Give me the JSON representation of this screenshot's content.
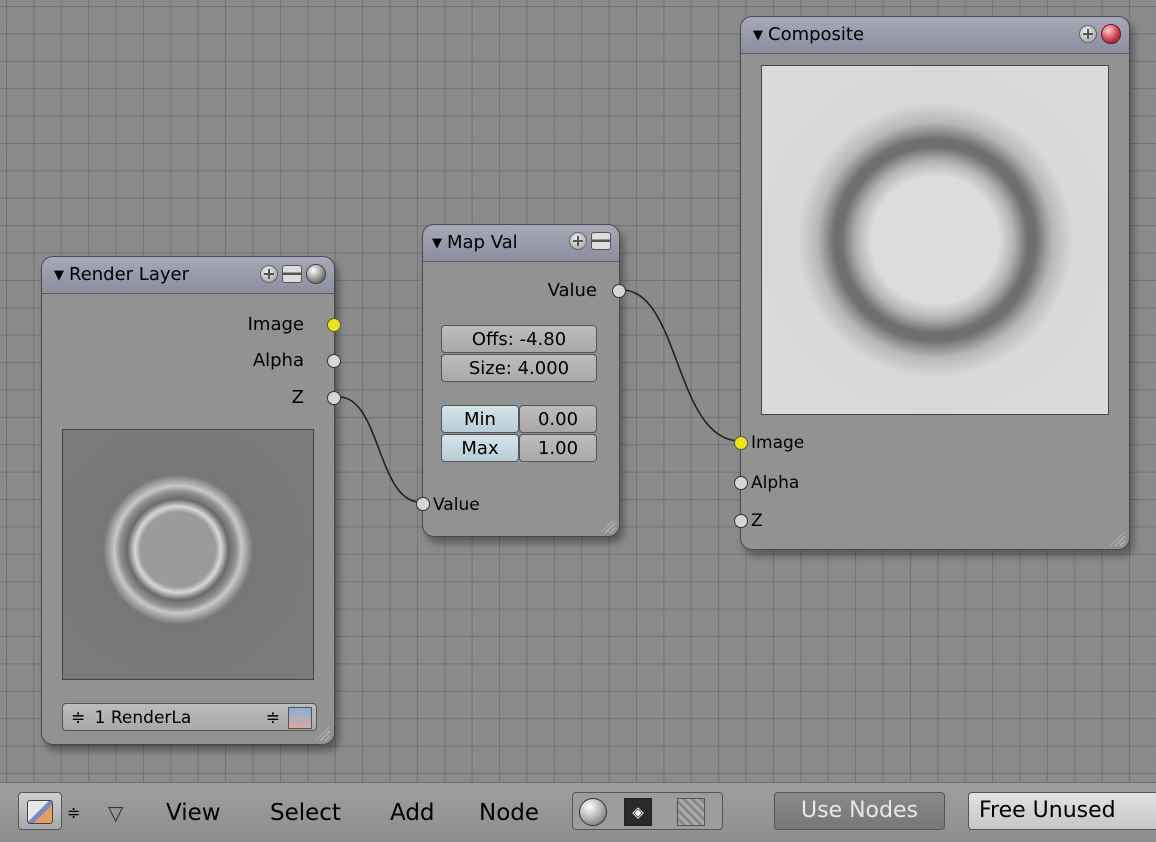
{
  "nodes": {
    "render_layer": {
      "title": "Render Layer",
      "outputs": [
        "Image",
        "Alpha",
        "Z"
      ],
      "layer_select": "1 RenderLa"
    },
    "map_value": {
      "title": "Map Val",
      "output": "Value",
      "input": "Value",
      "offs": "Offs: -4.80",
      "size": "Size: 4.000",
      "min_label": "Min",
      "min_value": "0.00",
      "max_label": "Max",
      "max_value": "1.00"
    },
    "composite": {
      "title": "Composite",
      "inputs": [
        "Image",
        "Alpha",
        "Z"
      ]
    }
  },
  "menubar": {
    "items": [
      "View",
      "Select",
      "Add",
      "Node"
    ],
    "use_nodes": "Use Nodes",
    "free_unused": "Free Unused"
  },
  "colors": {
    "grid_bg": "#8b8b8b",
    "node_body": "#929292",
    "node_header": "#9a9cad",
    "socket_image": "#ece41a",
    "socket_value": "#d6d6d6"
  }
}
